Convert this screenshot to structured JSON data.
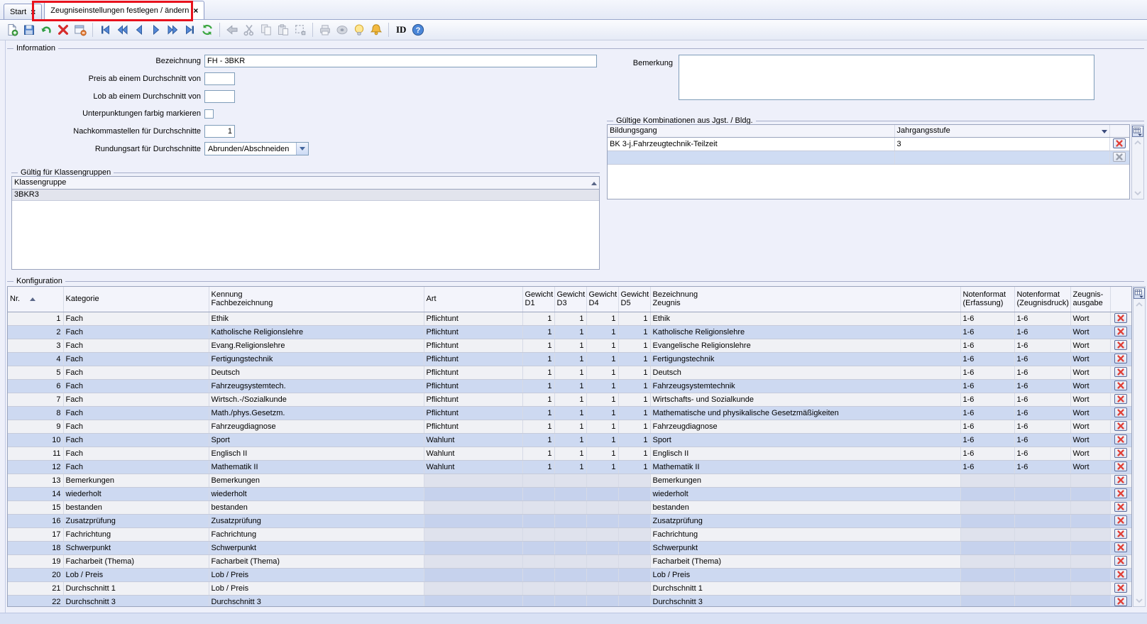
{
  "tabs": [
    {
      "label": "Start",
      "close": "×"
    },
    {
      "label": "Zeugniseinstellungen festlegen / ändern",
      "close": "×"
    }
  ],
  "toolbar": {
    "items": [
      {
        "name": "new-document-icon",
        "enabled": true
      },
      {
        "name": "save-icon",
        "enabled": true
      },
      {
        "name": "undo-icon",
        "enabled": true
      },
      {
        "name": "delete-record-icon",
        "enabled": true
      },
      {
        "name": "form-delete-icon",
        "enabled": true
      },
      {
        "sep": true
      },
      {
        "name": "first-record-icon",
        "enabled": true
      },
      {
        "name": "fast-backward-icon",
        "enabled": true
      },
      {
        "name": "previous-record-icon",
        "enabled": true
      },
      {
        "name": "next-record-icon",
        "enabled": true
      },
      {
        "name": "fast-forward-icon",
        "enabled": true
      },
      {
        "name": "last-record-icon",
        "enabled": true
      },
      {
        "name": "refresh-icon",
        "enabled": true
      },
      {
        "sep": true
      },
      {
        "name": "back-arrow-icon",
        "enabled": false
      },
      {
        "name": "cut-icon",
        "enabled": false
      },
      {
        "name": "copy-icon",
        "enabled": false
      },
      {
        "name": "paste-icon",
        "enabled": false
      },
      {
        "name": "select-region-icon",
        "enabled": false
      },
      {
        "sep": true
      },
      {
        "name": "print-icon",
        "enabled": false
      },
      {
        "name": "disc-icon",
        "enabled": false
      },
      {
        "name": "lamp-icon",
        "enabled": true
      },
      {
        "name": "bell-icon",
        "enabled": true
      },
      {
        "sep": true
      },
      {
        "label": "ID",
        "name": "id-label"
      },
      {
        "name": "help-icon",
        "enabled": true
      }
    ]
  },
  "information": {
    "legend": "Information",
    "bezeichnung_label": "Bezeichnung",
    "bezeichnung_value": "FH - 3BKR",
    "preis_label": "Preis ab einem Durchschnitt von",
    "preis_value": "",
    "lob_label": "Lob ab einem Durchschnitt von",
    "lob_value": "",
    "unterpunktungen_label": "Unterpunktungen farbig markieren",
    "unterpunktungen_checked": false,
    "nachkommastellen_label": "Nachkommastellen für Durchschnitte",
    "nachkommastellen_value": "1",
    "rundungsart_label": "Rundungsart für Durchschnitte",
    "rundungsart_value": "Abrunden/Abschneiden",
    "bemerkung_label": "Bemerkung",
    "bemerkung_value": ""
  },
  "klassengruppen": {
    "legend": "Gültig für Klassengruppen",
    "header": "Klassengruppe",
    "rows": [
      "3BKR3"
    ]
  },
  "kombinationen": {
    "legend": "Gültige Kombinationen aus Jgst. / Bldg.",
    "headers": {
      "bildungsgang": "Bildungsgang",
      "jahrgangsstufe": "Jahrgangsstufe"
    },
    "rows": [
      {
        "bildungsgang": "BK 3-j.Fahrzeugtechnik-Teilzeit",
        "jahrgangsstufe": "3"
      }
    ]
  },
  "konfiguration": {
    "legend": "Konfiguration",
    "headers": {
      "nr": [
        "Nr.",
        ""
      ],
      "kategorie": [
        "Kategorie",
        ""
      ],
      "kennung": [
        "Kennung",
        "Fachbezeichnung"
      ],
      "art": [
        "Art",
        ""
      ],
      "d1": [
        "Gewicht",
        "D1"
      ],
      "d3": [
        "Gewicht",
        "D3"
      ],
      "d4": [
        "Gewicht",
        "D4"
      ],
      "d5": [
        "Gewicht",
        "D5"
      ],
      "bezeichnung": [
        "Bezeichnung",
        "Zeugnis"
      ],
      "nf_erfassung": [
        "Notenformat",
        "(Erfassung)"
      ],
      "nf_zeugnisdruck": [
        "Notenformat",
        "(Zeugnisdruck)"
      ],
      "zeugnisausgabe": [
        "Zeugnis-",
        "ausgabe"
      ]
    },
    "rows": [
      {
        "nr": "1",
        "kategorie": "Fach",
        "kennung": "Ethik",
        "art": "Pflichtunt",
        "d1": "1",
        "d3": "1",
        "d4": "1",
        "d5": "1",
        "bezeichnung": "Ethik",
        "nf_erfassung": "1-6",
        "nf_zeugnisdruck": "1-6",
        "zeugnisausgabe": "Wort"
      },
      {
        "nr": "2",
        "kategorie": "Fach",
        "kennung": "Katholische Religionslehre",
        "art": "Pflichtunt",
        "d1": "1",
        "d3": "1",
        "d4": "1",
        "d5": "1",
        "bezeichnung": "Katholische Religionslehre",
        "nf_erfassung": "1-6",
        "nf_zeugnisdruck": "1-6",
        "zeugnisausgabe": "Wort"
      },
      {
        "nr": "3",
        "kategorie": "Fach",
        "kennung": "Evang.Religionslehre",
        "art": "Pflichtunt",
        "d1": "1",
        "d3": "1",
        "d4": "1",
        "d5": "1",
        "bezeichnung": "Evangelische Religionslehre",
        "nf_erfassung": "1-6",
        "nf_zeugnisdruck": "1-6",
        "zeugnisausgabe": "Wort"
      },
      {
        "nr": "4",
        "kategorie": "Fach",
        "kennung": "Fertigungstechnik",
        "art": "Pflichtunt",
        "d1": "1",
        "d3": "1",
        "d4": "1",
        "d5": "1",
        "bezeichnung": "Fertigungstechnik",
        "nf_erfassung": "1-6",
        "nf_zeugnisdruck": "1-6",
        "zeugnisausgabe": "Wort"
      },
      {
        "nr": "5",
        "kategorie": "Fach",
        "kennung": "Deutsch",
        "art": "Pflichtunt",
        "d1": "1",
        "d3": "1",
        "d4": "1",
        "d5": "1",
        "bezeichnung": "Deutsch",
        "nf_erfassung": "1-6",
        "nf_zeugnisdruck": "1-6",
        "zeugnisausgabe": "Wort"
      },
      {
        "nr": "6",
        "kategorie": "Fach",
        "kennung": "Fahrzeugsystemtech.",
        "art": "Pflichtunt",
        "d1": "1",
        "d3": "1",
        "d4": "1",
        "d5": "1",
        "bezeichnung": "Fahrzeugsystemtechnik",
        "nf_erfassung": "1-6",
        "nf_zeugnisdruck": "1-6",
        "zeugnisausgabe": "Wort"
      },
      {
        "nr": "7",
        "kategorie": "Fach",
        "kennung": "Wirtsch.-/Sozialkunde",
        "art": "Pflichtunt",
        "d1": "1",
        "d3": "1",
        "d4": "1",
        "d5": "1",
        "bezeichnung": "Wirtschafts- und Sozialkunde",
        "nf_erfassung": "1-6",
        "nf_zeugnisdruck": "1-6",
        "zeugnisausgabe": "Wort"
      },
      {
        "nr": "8",
        "kategorie": "Fach",
        "kennung": "Math./phys.Gesetzm.",
        "art": "Pflichtunt",
        "d1": "1",
        "d3": "1",
        "d4": "1",
        "d5": "1",
        "bezeichnung": "Mathematische und physikalische Gesetzmäßigkeiten",
        "nf_erfassung": "1-6",
        "nf_zeugnisdruck": "1-6",
        "zeugnisausgabe": "Wort"
      },
      {
        "nr": "9",
        "kategorie": "Fach",
        "kennung": "Fahrzeugdiagnose",
        "art": "Pflichtunt",
        "d1": "1",
        "d3": "1",
        "d4": "1",
        "d5": "1",
        "bezeichnung": "Fahrzeugdiagnose",
        "nf_erfassung": "1-6",
        "nf_zeugnisdruck": "1-6",
        "zeugnisausgabe": "Wort"
      },
      {
        "nr": "10",
        "kategorie": "Fach",
        "kennung": "Sport",
        "art": "Wahlunt",
        "d1": "1",
        "d3": "1",
        "d4": "1",
        "d5": "1",
        "bezeichnung": "Sport",
        "nf_erfassung": "1-6",
        "nf_zeugnisdruck": "1-6",
        "zeugnisausgabe": "Wort"
      },
      {
        "nr": "11",
        "kategorie": "Fach",
        "kennung": "Englisch II",
        "art": "Wahlunt",
        "d1": "1",
        "d3": "1",
        "d4": "1",
        "d5": "1",
        "bezeichnung": "Englisch II",
        "nf_erfassung": "1-6",
        "nf_zeugnisdruck": "1-6",
        "zeugnisausgabe": "Wort"
      },
      {
        "nr": "12",
        "kategorie": "Fach",
        "kennung": "Mathematik II",
        "art": "Wahlunt",
        "d1": "1",
        "d3": "1",
        "d4": "1",
        "d5": "1",
        "bezeichnung": "Mathematik II",
        "nf_erfassung": "1-6",
        "nf_zeugnisdruck": "1-6",
        "zeugnisausgabe": "Wort"
      },
      {
        "nr": "13",
        "kategorie": "Bemerkungen",
        "kennung": "Bemerkungen",
        "art": "",
        "d1": "",
        "d3": "",
        "d4": "",
        "d5": "",
        "bezeichnung": "Bemerkungen",
        "nf_erfassung": "",
        "nf_zeugnisdruck": "",
        "zeugnisausgabe": ""
      },
      {
        "nr": "14",
        "kategorie": "wiederholt",
        "kennung": "wiederholt",
        "art": "",
        "d1": "",
        "d3": "",
        "d4": "",
        "d5": "",
        "bezeichnung": "wiederholt",
        "nf_erfassung": "",
        "nf_zeugnisdruck": "",
        "zeugnisausgabe": ""
      },
      {
        "nr": "15",
        "kategorie": "bestanden",
        "kennung": "bestanden",
        "art": "",
        "d1": "",
        "d3": "",
        "d4": "",
        "d5": "",
        "bezeichnung": "bestanden",
        "nf_erfassung": "",
        "nf_zeugnisdruck": "",
        "zeugnisausgabe": ""
      },
      {
        "nr": "16",
        "kategorie": "Zusatzprüfung",
        "kennung": "Zusatzprüfung",
        "art": "",
        "d1": "",
        "d3": "",
        "d4": "",
        "d5": "",
        "bezeichnung": "Zusatzprüfung",
        "nf_erfassung": "",
        "nf_zeugnisdruck": "",
        "zeugnisausgabe": ""
      },
      {
        "nr": "17",
        "kategorie": "Fachrichtung",
        "kennung": "Fachrichtung",
        "art": "",
        "d1": "",
        "d3": "",
        "d4": "",
        "d5": "",
        "bezeichnung": "Fachrichtung",
        "nf_erfassung": "",
        "nf_zeugnisdruck": "",
        "zeugnisausgabe": ""
      },
      {
        "nr": "18",
        "kategorie": "Schwerpunkt",
        "kennung": "Schwerpunkt",
        "art": "",
        "d1": "",
        "d3": "",
        "d4": "",
        "d5": "",
        "bezeichnung": "Schwerpunkt",
        "nf_erfassung": "",
        "nf_zeugnisdruck": "",
        "zeugnisausgabe": ""
      },
      {
        "nr": "19",
        "kategorie": "Facharbeit (Thema)",
        "kennung": "Facharbeit (Thema)",
        "art": "",
        "d1": "",
        "d3": "",
        "d4": "",
        "d5": "",
        "bezeichnung": "Facharbeit (Thema)",
        "nf_erfassung": "",
        "nf_zeugnisdruck": "",
        "zeugnisausgabe": ""
      },
      {
        "nr": "20",
        "kategorie": "Lob / Preis",
        "kennung": "Lob / Preis",
        "art": "",
        "d1": "",
        "d3": "",
        "d4": "",
        "d5": "",
        "bezeichnung": "Lob / Preis",
        "nf_erfassung": "",
        "nf_zeugnisdruck": "",
        "zeugnisausgabe": ""
      },
      {
        "nr": "21",
        "kategorie": "Durchschnitt 1",
        "kennung": "Lob / Preis",
        "art": "",
        "d1": "",
        "d3": "",
        "d4": "",
        "d5": "",
        "bezeichnung": "Durchschnitt 1",
        "nf_erfassung": "",
        "nf_zeugnisdruck": "",
        "zeugnisausgabe": ""
      },
      {
        "nr": "22",
        "kategorie": "Durchschnitt 3",
        "kennung": "Durchschnitt 3",
        "art": "",
        "d1": "",
        "d3": "",
        "d4": "",
        "d5": "",
        "bezeichnung": "Durchschnitt 3",
        "nf_erfassung": "",
        "nf_zeugnisdruck": "",
        "zeugnisausgabe": ""
      }
    ]
  },
  "colors": {
    "accent_annotation": "#e8121d",
    "row_even": "#cdd9f1",
    "row_odd": "#f0f1f5",
    "delete_x": "#e04038"
  }
}
